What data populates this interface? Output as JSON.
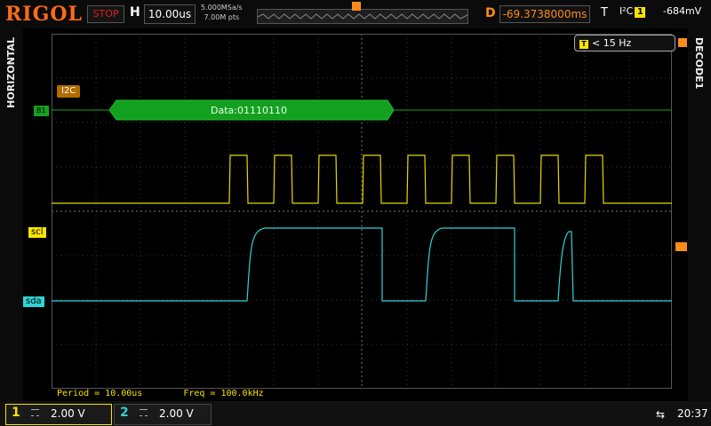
{
  "header": {
    "brand": "RIGOL",
    "run_state": "STOP",
    "horizontal_label": "H",
    "timebase": "10.00us",
    "sample_rate": "5.000MSa/s",
    "memory_depth": "7.00M pts",
    "delay_label": "D",
    "delay_value": "-69.3738000ms",
    "trigger_label": "T",
    "trigger_type": "I²C",
    "trigger_channel": "1",
    "trigger_level": "-684mV"
  },
  "side": {
    "left_menu": "HORIZONTAL",
    "right_menu": "DECODE1"
  },
  "counter": {
    "value": "< 15 Hz"
  },
  "waveform": {
    "bus_label": "I2C",
    "bus_tag": "B1",
    "packet_text": "Data:01110110",
    "scl_tag": "scl",
    "sda_tag": "sda"
  },
  "measurements": {
    "period": "Period = 10.00us",
    "freq": "Freq = 100.0kHz"
  },
  "channels": [
    {
      "num": "1",
      "scale": "2.00 V",
      "color": "#f7e400"
    },
    {
      "num": "2",
      "scale": "2.00 V",
      "color": "#2fd3d6"
    }
  ],
  "status": {
    "time": "20:37"
  },
  "colors": {
    "bus": "#13a020",
    "ch1": "#f7e400",
    "ch2": "#2fd3d6",
    "accent": "#ff8c1a"
  }
}
